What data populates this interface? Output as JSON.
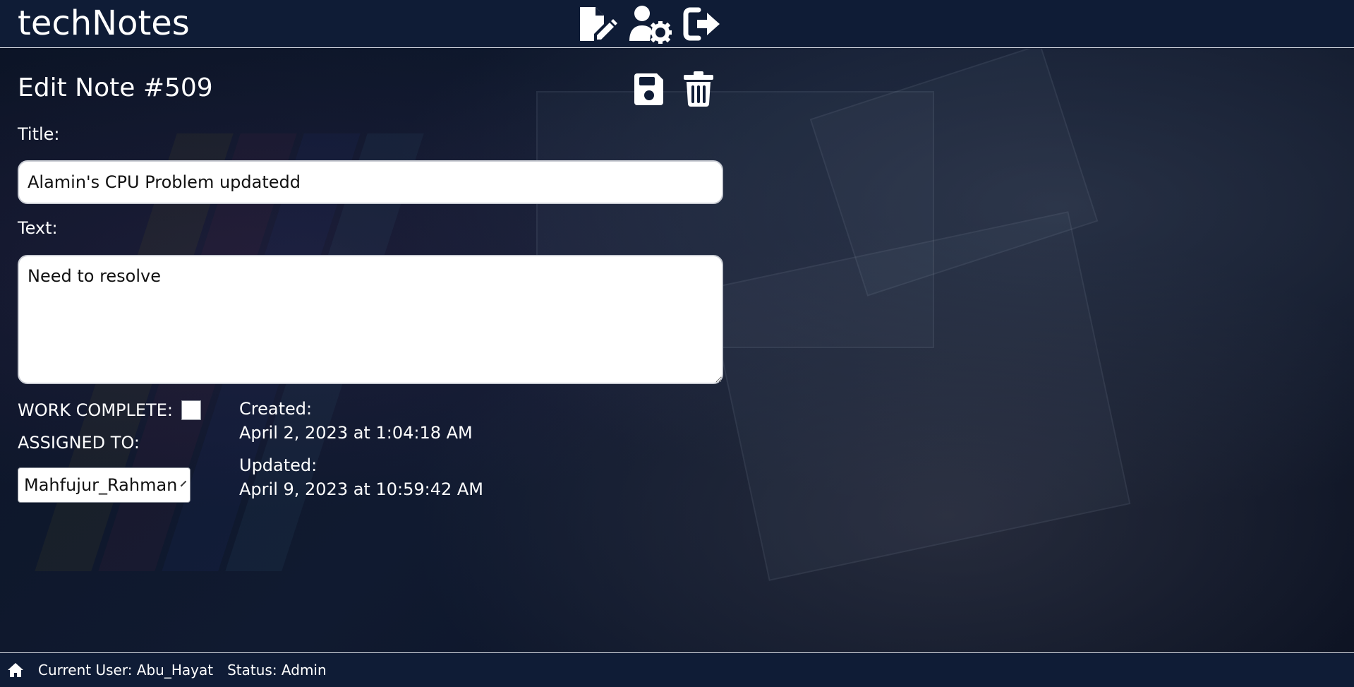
{
  "header": {
    "brand": "techNotes",
    "nav_icons": [
      "new-note-icon",
      "user-settings-icon",
      "logout-icon"
    ]
  },
  "form": {
    "heading": "Edit Note #509",
    "actions": [
      "save-icon",
      "trash-icon"
    ],
    "title_label": "Title:",
    "title_value": "Alamin's CPU Problem updatedd",
    "text_label": "Text:",
    "text_value": "Need to resolve",
    "work_complete_label": "WORK COMPLETE:",
    "work_complete_checked": false,
    "assigned_label": "ASSIGNED TO:",
    "assigned_value": "Mahfujur_Rahman",
    "created_label": "Created:",
    "created_value": "April 2, 2023 at 1:04:18 AM",
    "updated_label": "Updated:",
    "updated_value": "April 9, 2023 at 10:59:42 AM"
  },
  "footer": {
    "home_icon": "home-icon",
    "current_user": "Current User: Abu_Hayat",
    "status": "Status: Admin"
  },
  "colors": {
    "header_bg": "#0f1c36",
    "page_bg": "#0c1426",
    "text": "#ffffff",
    "input_bg": "#ffffff"
  }
}
